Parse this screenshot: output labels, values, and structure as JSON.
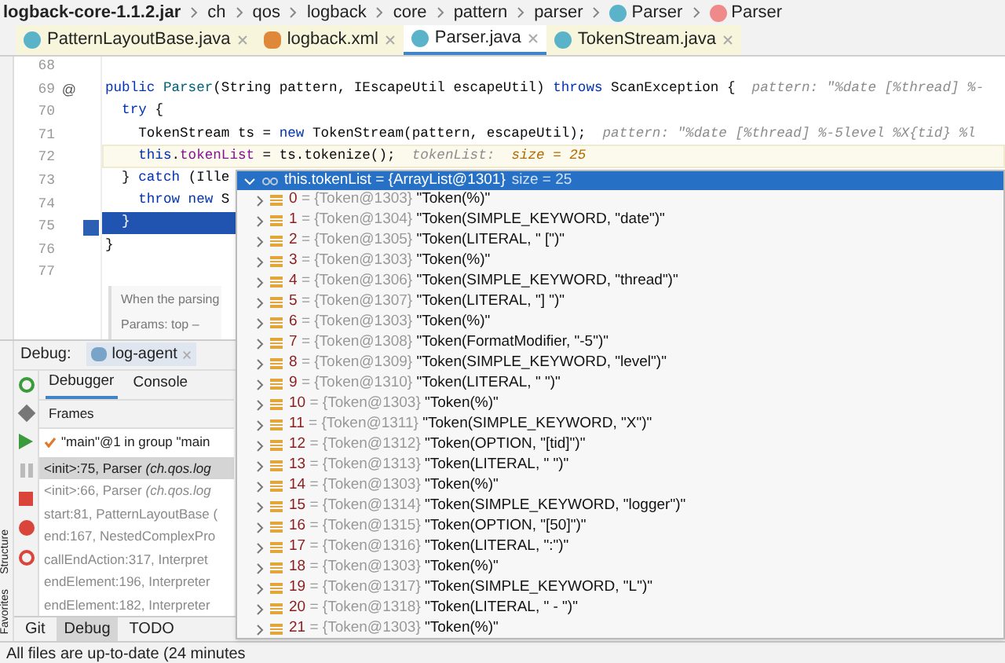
{
  "breadcrumb": [
    {
      "label": "logback-core-1.1.2.jar",
      "kind": "jar"
    },
    {
      "label": "ch",
      "kind": "package"
    },
    {
      "label": "qos",
      "kind": "package"
    },
    {
      "label": "logback",
      "kind": "package"
    },
    {
      "label": "core",
      "kind": "package"
    },
    {
      "label": "pattern",
      "kind": "package"
    },
    {
      "label": "parser",
      "kind": "package"
    },
    {
      "label": "Parser",
      "kind": "class"
    },
    {
      "label": "Parser",
      "kind": "method"
    }
  ],
  "tabs": [
    {
      "label": "PatternLayoutBase.java",
      "kind": "class",
      "selected": false
    },
    {
      "label": "logback.xml",
      "kind": "xml",
      "selected": false
    },
    {
      "label": "Parser.java",
      "kind": "class",
      "selected": true
    },
    {
      "label": "TokenStream.java",
      "kind": "class",
      "selected": false
    }
  ],
  "side_tabs": [
    "Structure",
    "Favorites"
  ],
  "editor": {
    "lines": [
      {
        "number": "68",
        "current_line": false,
        "execution_point": false
      },
      {
        "number": "69",
        "current_line": false,
        "execution_point": false,
        "annotation": "@",
        "segments": [
          {
            "t": "public ",
            "kind": "kw"
          },
          {
            "t": "Parser",
            "kind": "method"
          },
          {
            "t": "(String pattern, IEscapeUtil escapeUtil) ",
            "kind": "plain"
          },
          {
            "t": "throws ",
            "kind": "kw"
          },
          {
            "t": "ScanException {",
            "kind": "plain"
          },
          {
            "t": "  pattern: \"%date [%thread] %-",
            "kind": "hint"
          }
        ]
      },
      {
        "number": "70",
        "current_line": false,
        "execution_point": false,
        "segments": [
          {
            "t": "  try ",
            "kind": "kw"
          },
          {
            "t": "{",
            "kind": "plain"
          }
        ]
      },
      {
        "number": "71",
        "current_line": false,
        "execution_point": false,
        "segments": [
          {
            "t": "    TokenStream ts = ",
            "kind": "plain"
          },
          {
            "t": "new ",
            "kind": "kw"
          },
          {
            "t": "TokenStream(pattern, escapeUtil);",
            "kind": "plain"
          },
          {
            "t": "  pattern: \"%date [%thread] %-5level %X{tid} %l",
            "kind": "hint"
          }
        ]
      },
      {
        "number": "72",
        "current_line": true,
        "execution_point": false,
        "segments": [
          {
            "t": "    this",
            "kind": "kw"
          },
          {
            "t": ".",
            "kind": "plain"
          },
          {
            "t": "tokenList",
            "kind": "field"
          },
          {
            "t": " = ts.tokenize();",
            "kind": "plain"
          },
          {
            "t": "  tokenList:  ",
            "kind": "hint"
          },
          {
            "t": "size = 25",
            "kind": "hintval"
          }
        ]
      },
      {
        "number": "73",
        "current_line": false,
        "execution_point": false,
        "segments": [
          {
            "t": "  } ",
            "kind": "plain"
          },
          {
            "t": "catch ",
            "kind": "kw"
          },
          {
            "t": "(Ille",
            "kind": "plain"
          }
        ]
      },
      {
        "number": "74",
        "current_line": false,
        "execution_point": false,
        "segments": [
          {
            "t": "    throw new ",
            "kind": "kw"
          },
          {
            "t": "S",
            "kind": "plain"
          }
        ]
      },
      {
        "number": "75",
        "current_line": false,
        "execution_point": true,
        "segments": [
          {
            "t": "  }",
            "kind": "plain"
          }
        ]
      },
      {
        "number": "76",
        "current_line": false,
        "execution_point": false,
        "segments": [
          {
            "t": "}",
            "kind": "plain"
          }
        ]
      },
      {
        "number": "77",
        "current_line": false,
        "execution_point": false
      }
    ],
    "doc": [
      "When the parsing",
      "Params: top –"
    ]
  },
  "debug": {
    "title": "Debug:",
    "session": "log-agent",
    "tabs": [
      {
        "label": "Debugger",
        "selected": true
      },
      {
        "label": "Console",
        "selected": false
      }
    ],
    "frames_title": "Frames",
    "thread": "\"main\"@1 in group \"main",
    "frames": [
      {
        "text": "<init>:75, Parser *(ch.qos.log*",
        "selected": true,
        "library": false
      },
      {
        "text": "<init>:66, Parser *(ch.qos.log*",
        "selected": false,
        "library": true
      },
      {
        "text": "start:81, PatternLayoutBase (",
        "selected": false,
        "library": true
      },
      {
        "text": "end:167, NestedComplexPro",
        "selected": false,
        "library": true
      },
      {
        "text": "callEndAction:317, Interpret",
        "selected": false,
        "library": true
      },
      {
        "text": "endElement:196, Interpreter",
        "selected": false,
        "library": true
      },
      {
        "text": "endElement:182, Interpreter",
        "selected": false,
        "library": true
      }
    ]
  },
  "popup": {
    "header": "this.tokenList = {ArrayList@1301}",
    "size": "size = 25",
    "rows": [
      {
        "index": "0",
        "ref": "= {Token@1303}",
        "value": "\"Token(%)\""
      },
      {
        "index": "1",
        "ref": "= {Token@1304}",
        "value": "\"Token(SIMPLE_KEYWORD, \"date\")\""
      },
      {
        "index": "2",
        "ref": "= {Token@1305}",
        "value": "\"Token(LITERAL, \" [\")\""
      },
      {
        "index": "3",
        "ref": "= {Token@1303}",
        "value": "\"Token(%)\""
      },
      {
        "index": "4",
        "ref": "= {Token@1306}",
        "value": "\"Token(SIMPLE_KEYWORD, \"thread\")\""
      },
      {
        "index": "5",
        "ref": "= {Token@1307}",
        "value": "\"Token(LITERAL, \"] \")\""
      },
      {
        "index": "6",
        "ref": "= {Token@1303}",
        "value": "\"Token(%)\""
      },
      {
        "index": "7",
        "ref": "= {Token@1308}",
        "value": "\"Token(FormatModifier, \"-5\")\""
      },
      {
        "index": "8",
        "ref": "= {Token@1309}",
        "value": "\"Token(SIMPLE_KEYWORD, \"level\")\""
      },
      {
        "index": "9",
        "ref": "= {Token@1310}",
        "value": "\"Token(LITERAL, \" \")\""
      },
      {
        "index": "10",
        "ref": "= {Token@1303}",
        "value": "\"Token(%)\""
      },
      {
        "index": "11",
        "ref": "= {Token@1311}",
        "value": "\"Token(SIMPLE_KEYWORD, \"X\")\""
      },
      {
        "index": "12",
        "ref": "= {Token@1312}",
        "value": "\"Token(OPTION, \"[tid]\")\""
      },
      {
        "index": "13",
        "ref": "= {Token@1313}",
        "value": "\"Token(LITERAL, \" \")\""
      },
      {
        "index": "14",
        "ref": "= {Token@1303}",
        "value": "\"Token(%)\""
      },
      {
        "index": "15",
        "ref": "= {Token@1314}",
        "value": "\"Token(SIMPLE_KEYWORD, \"logger\")\""
      },
      {
        "index": "16",
        "ref": "= {Token@1315}",
        "value": "\"Token(OPTION, \"[50]\")\""
      },
      {
        "index": "17",
        "ref": "= {Token@1316}",
        "value": "\"Token(LITERAL, \":\")\""
      },
      {
        "index": "18",
        "ref": "= {Token@1303}",
        "value": "\"Token(%)\""
      },
      {
        "index": "19",
        "ref": "= {Token@1317}",
        "value": "\"Token(SIMPLE_KEYWORD, \"L\")\""
      },
      {
        "index": "20",
        "ref": "= {Token@1318}",
        "value": "\"Token(LITERAL, \" - \")\""
      },
      {
        "index": "21",
        "ref": "= {Token@1303}",
        "value": "\"Token(%)\""
      }
    ]
  },
  "tool_tabs": [
    {
      "label": "Git",
      "selected": false
    },
    {
      "label": "Debug",
      "selected": true
    },
    {
      "label": "TODO",
      "selected": false
    }
  ],
  "status": "All files are up-to-date (24 minutes"
}
